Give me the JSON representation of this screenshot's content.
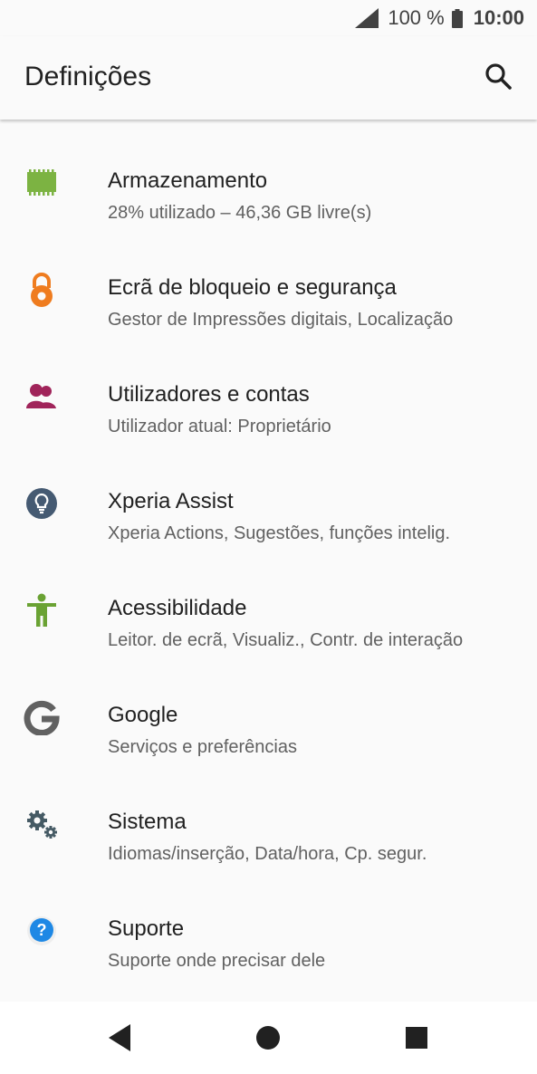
{
  "status_bar": {
    "battery_percent": "100 %",
    "time": "10:00",
    "signal_icon": "signal-icon",
    "battery_icon": "battery-icon"
  },
  "app_bar": {
    "title": "Definições",
    "search_icon": "search-icon"
  },
  "settings": [
    {
      "label": "Armazenamento",
      "subtitle": "28% utilizado – 46,36 GB livre(s)",
      "icon": "storage-chip-icon",
      "color": "#7cb342"
    },
    {
      "label": "Ecrã de bloqueio e segurança",
      "subtitle": "Gestor de Impressões digitais, Localização",
      "icon": "lock-icon",
      "color": "#ef7c1f"
    },
    {
      "label": "Utilizadores e contas",
      "subtitle": "Utilizador atual: Proprietário",
      "icon": "users-icon",
      "color": "#a0245a"
    },
    {
      "label": "Xperia Assist",
      "subtitle": "Xperia Actions, Sugestões, funções intelig.",
      "icon": "lightbulb-icon",
      "color": "#455a72"
    },
    {
      "label": "Acessibilidade",
      "subtitle": "Leitor. de ecrã, Visualiz., Contr. de interação",
      "icon": "accessibility-icon",
      "color": "#6aa233"
    },
    {
      "label": "Google",
      "subtitle": "Serviços e preferências",
      "icon": "google-icon",
      "color": "#616161"
    },
    {
      "label": "Sistema",
      "subtitle": "Idiomas/inserção, Data/hora, Cp. segur.",
      "icon": "gears-icon",
      "color": "#455a64"
    },
    {
      "label": "Suporte",
      "subtitle": "Suporte onde precisar dele",
      "icon": "help-icon",
      "color": "#1e88e5"
    }
  ],
  "nav_bar": {
    "back_icon": "back-icon",
    "home_icon": "home-icon",
    "recents_icon": "recents-icon"
  }
}
